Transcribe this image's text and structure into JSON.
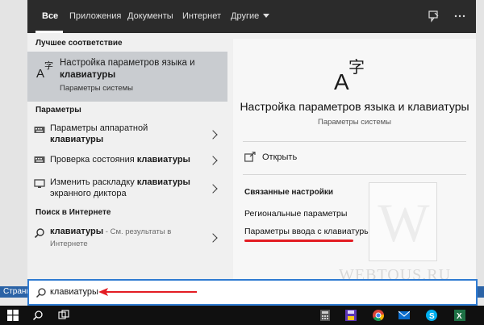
{
  "background": {
    "strip_label": "Страни"
  },
  "tabs": [
    {
      "label": "Все",
      "active": true
    },
    {
      "label": "Приложения"
    },
    {
      "label": "Документы"
    },
    {
      "label": "Интернет"
    },
    {
      "label": "Другие"
    }
  ],
  "left": {
    "best_match_header": "Лучшее соответствие",
    "best_match": {
      "title_line1": "Настройка параметров языка и",
      "title_line2": "клавиатуры",
      "subtitle": "Параметры системы",
      "icon": "language-keyboard-icon"
    },
    "settings_header": "Параметры",
    "settings_items": [
      {
        "line1": "Параметры аппаратной",
        "line2": "клавиатуры",
        "icon": "keyboard-icon"
      },
      {
        "line1_prefix": "Проверка состояния ",
        "line1_bold": "клавиатуры",
        "icon": "keyboard-icon"
      },
      {
        "line1_prefix": "Изменить раскладку ",
        "line1_bold": "клавиатуры",
        "line2": "экранного диктора",
        "icon": "monitor-icon"
      }
    ],
    "web_header": "Поиск в Интернете",
    "web_item": {
      "bold": "клавиатуры",
      "suffix": " - См. результаты в",
      "line2": "Интернете",
      "icon": "search-icon"
    }
  },
  "detail": {
    "title": "Настройка параметров языка и клавиатуры",
    "subtitle": "Параметры системы",
    "open_label": "Открыть",
    "related_header": "Связанные настройки",
    "related_links": [
      "Региональные параметры",
      "Параметры ввода с клавиатуры"
    ],
    "watermark_letter": "W"
  },
  "watermark_text": "WEBTOUS.RU",
  "search": {
    "value": "клавиатуры"
  },
  "colors": {
    "accent": "#2f7bd1",
    "highlight": "#c9ccd0",
    "topbar": "#2b2b2b",
    "annotation": "#e31c23"
  }
}
